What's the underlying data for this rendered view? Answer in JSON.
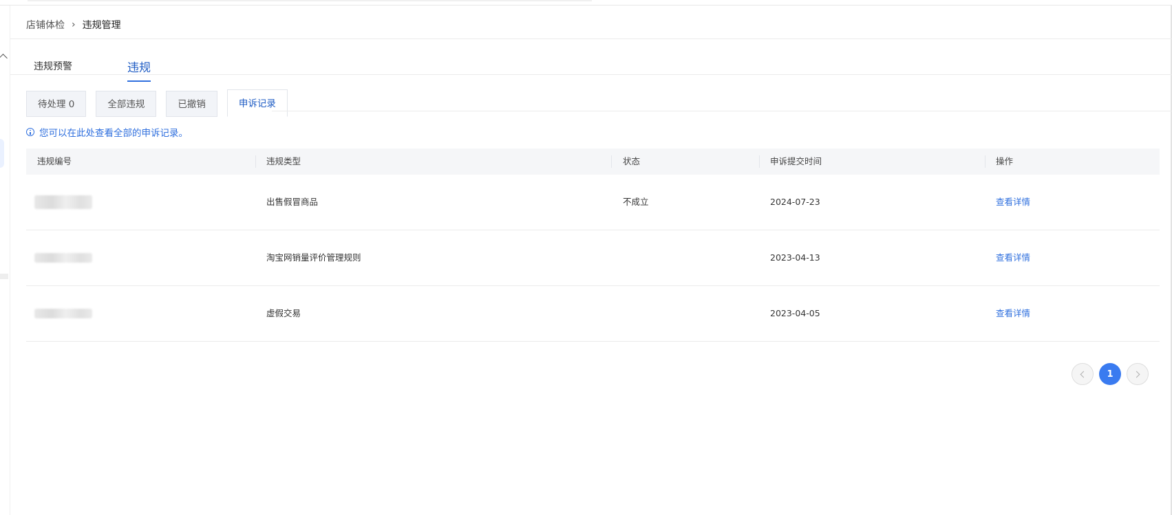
{
  "breadcrumb": {
    "parent": "店铺体检",
    "separator": "›",
    "current": "违规管理"
  },
  "main_tabs": [
    {
      "label": "违规预警",
      "active": false
    },
    {
      "label": "违规",
      "active": true
    }
  ],
  "sub_tabs": [
    {
      "label": "待处理 0",
      "active": false
    },
    {
      "label": "全部违规",
      "active": false
    },
    {
      "label": "已撤销",
      "active": false
    },
    {
      "label": "申诉记录",
      "active": true
    }
  ],
  "info_text": "您可以在此处查看全部的申诉记录。",
  "table": {
    "columns": [
      "违规编号",
      "违规类型",
      "状态",
      "申诉提交时间",
      "操作"
    ],
    "rows": [
      {
        "type": "出售假冒商品",
        "status": "不成立",
        "date": "2024-07-23",
        "action": "查看详情"
      },
      {
        "type": "淘宝网销量评价管理规则",
        "status": "",
        "date": "2023-04-13",
        "action": "查看详情"
      },
      {
        "type": "虚假交易",
        "status": "",
        "date": "2023-04-05",
        "action": "查看详情"
      }
    ]
  },
  "pagination": {
    "current": "1"
  },
  "icons": {
    "info": "info-circle-icon",
    "prev": "chevron-left-icon",
    "next": "chevron-right-icon",
    "collapse": "chevron-up-icon"
  },
  "colors": {
    "accent": "#2f6fde",
    "active_page": "#3a7bf0",
    "header_bg": "#f5f6f8"
  }
}
